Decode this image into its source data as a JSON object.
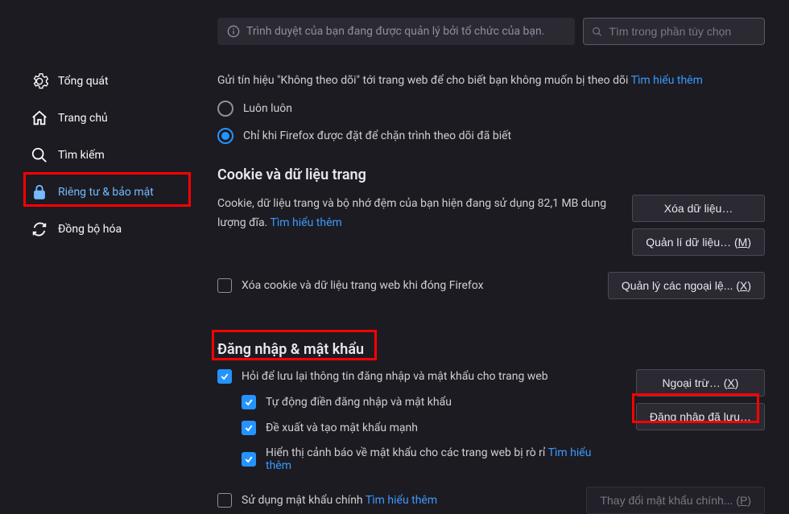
{
  "sidebar": {
    "items": [
      {
        "label": "Tổng quát"
      },
      {
        "label": "Trang chủ"
      },
      {
        "label": "Tìm kiếm"
      },
      {
        "label": "Riêng tư & bảo mật"
      },
      {
        "label": "Đồng bộ hóa"
      }
    ]
  },
  "topbar": {
    "managed_notice": "Trình duyệt của bạn đang được quản lý bởi tổ chức của bạn.",
    "search_placeholder": "Tìm trong phần tùy chọn"
  },
  "dnt": {
    "desc_prefix": "Gửi tín hiệu \"Không theo dõi\" tới trang web để cho biết bạn không muốn bị theo dõi  ",
    "learn_more": "Tìm hiểu thêm",
    "always": "Luôn luôn",
    "only_blocking": "Chỉ khi Firefox được đặt để chặn trình theo dõi đã biết"
  },
  "cookies": {
    "title": "Cookie và dữ liệu trang",
    "usage_line": "Cookie, dữ liệu trang và bộ nhớ đệm của bạn hiện đang sử dụng 82,1 MB dung lượng đĩa.  ",
    "learn_more": "Tìm hiểu thêm",
    "btn_clear": "Xóa dữ liệu…",
    "btn_manage_prefix": "Quản lí dữ liệu… (",
    "btn_manage_key": "M",
    "btn_exceptions_prefix": "Quản lý các ngoại lệ... (",
    "btn_exceptions_key": "X",
    "delete_on_close_prefix": "Xóa ",
    "delete_on_close_key": "c",
    "delete_on_close_suffix": "ookie và dữ liệu trang web khi đóng Firefox"
  },
  "logins": {
    "title": "Đăng nhập & mật khẩu",
    "ask_save": "Hỏi để lưu lại thông tin đăng nhập và mật khẩu cho trang web",
    "autofill": "Tự động điền đăng nhập và mật khẩu",
    "suggest": "Đề xuất và tạo mật khẩu mạnh",
    "breach_warn": "Hiển thị cảnh báo về mật khẩu cho các trang web bị rò rỉ  ",
    "breach_learn": "Tìm hiểu thêm",
    "master_pw": "Sử dụng mật khẩu chính  ",
    "master_learn": "Tìm hiểu thêm",
    "btn_except_prefix": "Ngoại trừ… (",
    "btn_except_key": "X",
    "btn_saved_prefix": "Đăng nhập đã ",
    "btn_saved_key": "l",
    "btn_saved_suffix": "ưu…",
    "btn_master_prefix": "Thay đổi mật khẩu chính... (",
    "btn_master_key": "P"
  },
  "close_paren": ")"
}
